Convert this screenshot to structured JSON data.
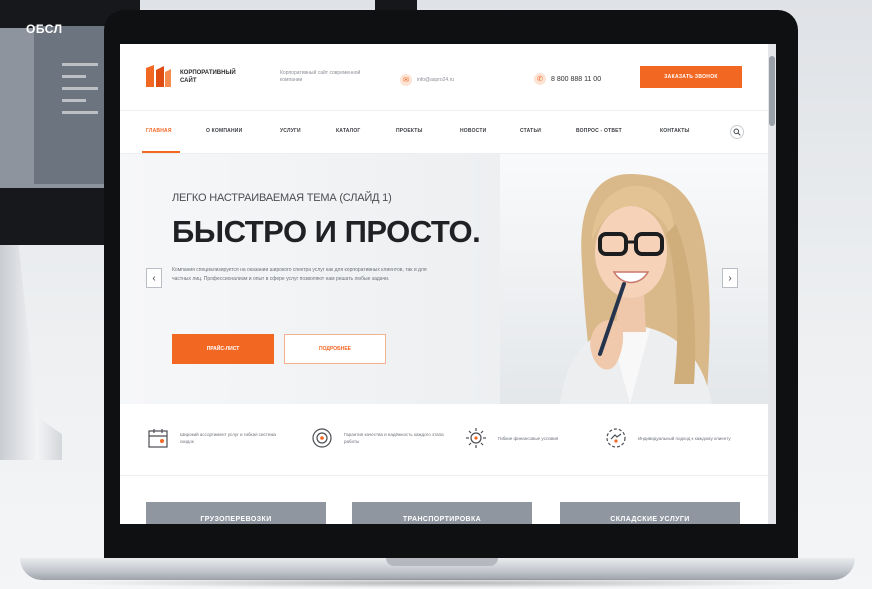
{
  "background": {
    "card_title": "ОБСЛ"
  },
  "header": {
    "logo_text": "КОРПОРАТИВНЫЙ САЙТ",
    "tagline": "Корпоративный сайт современной компании",
    "email": "info@aspro24.ru",
    "phone": "8 800 888 11 00",
    "cta_label": "ЗАКАЗАТЬ ЗВОНОК"
  },
  "nav": {
    "items": [
      {
        "label": "ГЛАВНАЯ"
      },
      {
        "label": "О КОМПАНИИ"
      },
      {
        "label": "УСЛУГИ"
      },
      {
        "label": "КАТАЛОГ"
      },
      {
        "label": "ПРОЕКТЫ"
      },
      {
        "label": "НОВОСТИ"
      },
      {
        "label": "СТАТЬИ"
      },
      {
        "label": "ВОПРОС - ОТВЕТ"
      },
      {
        "label": "КОНТАКТЫ"
      }
    ],
    "active_index": 0
  },
  "hero": {
    "subtitle": "ЛЕГКО НАСТРАИВАЕМАЯ ТЕМА (СЛАЙД 1)",
    "title": "БЫСТРО И ПРОСТО.",
    "text": "Компания специализируется на оказании широкого спектра услуг как для корпоративных клиентов, так и для частных лиц. Профессионализм и опыт в сфере услуг позволяют нам решать любые задачи.",
    "primary_button": "ПРАЙС-ЛИСТ",
    "secondary_button": "ПОДРОБНЕЕ"
  },
  "features": [
    {
      "text": "Широкий ассортимент услуг и гибкая система скидок"
    },
    {
      "text": "Гарантия качества и надёжность каждого этапа работы"
    },
    {
      "text": "Гибкие финансовые условия"
    },
    {
      "text": "Индивидуальный подход к каждому клиенту"
    }
  ],
  "cards": [
    {
      "label": "ГРУЗОПЕРЕВОЗКИ"
    },
    {
      "label": "ТРАНСПОРТИРОВКА"
    },
    {
      "label": "СКЛАДСКИЕ УСЛУГИ"
    }
  ],
  "colors": {
    "accent": "#f26722",
    "card": "#8f969f",
    "text_dark": "#1f2124"
  }
}
